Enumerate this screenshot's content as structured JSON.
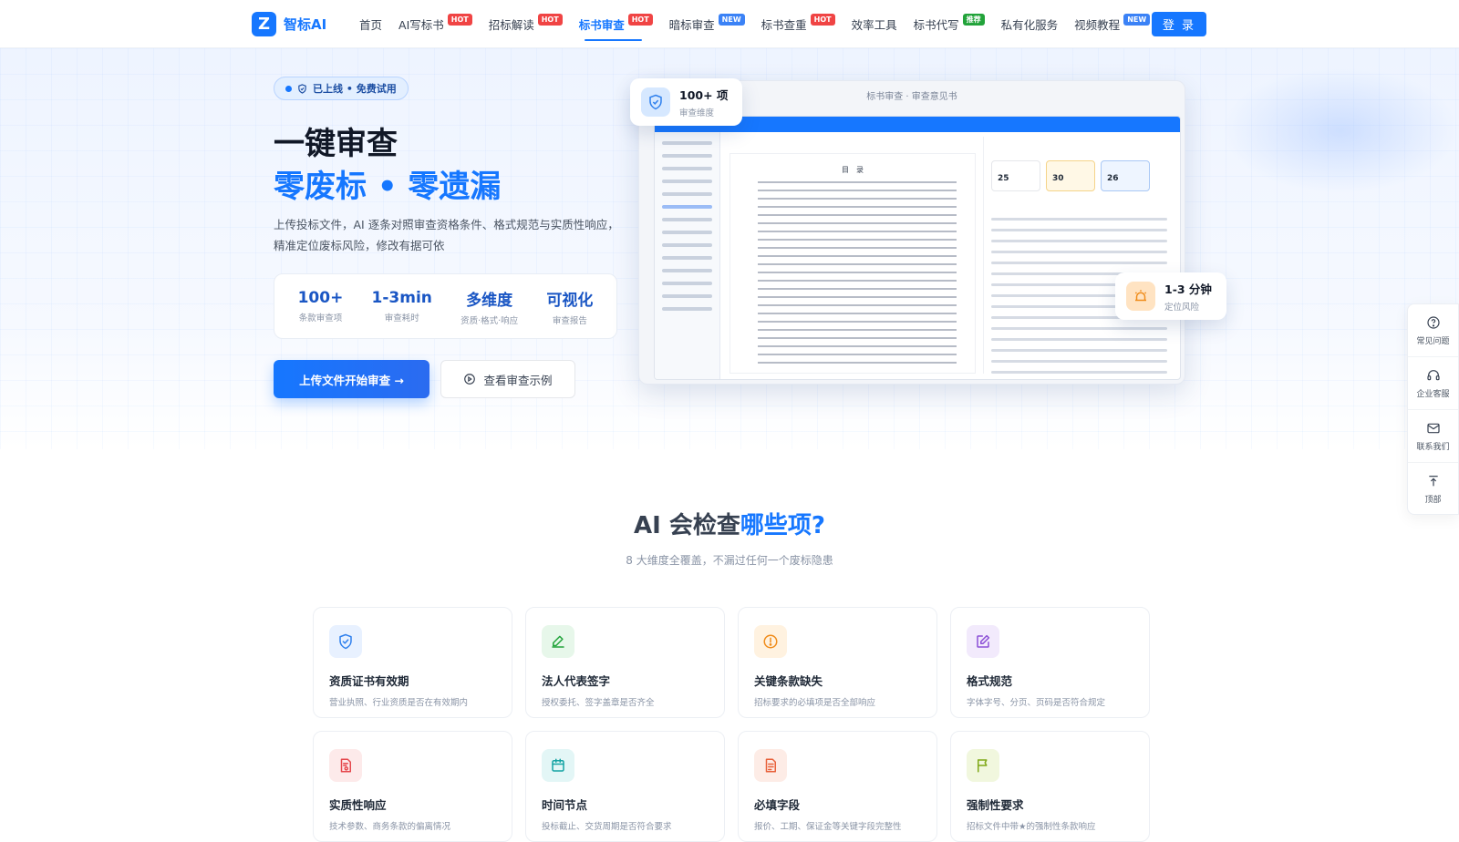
{
  "nav": {
    "logo_mark": "Z",
    "logo_text": "智标AI",
    "items": [
      {
        "label": "首页",
        "badge": ""
      },
      {
        "label": "AI写标书",
        "badge": "HOT"
      },
      {
        "label": "招标解读",
        "badge": "HOT"
      },
      {
        "label": "标书审查",
        "badge": "HOT"
      },
      {
        "label": "暗标审查",
        "badge": "NEW"
      },
      {
        "label": "标书查重",
        "badge": "HOT"
      },
      {
        "label": "效率工具",
        "badge": ""
      },
      {
        "label": "标书代写",
        "badge": "推荐"
      },
      {
        "label": "私有化服务",
        "badge": ""
      },
      {
        "label": "视频教程",
        "badge": "NEW"
      }
    ],
    "active_item": "标书审查",
    "login_label": "登 录"
  },
  "hero": {
    "pill": "已上线 • 免费试用",
    "headline_1": "一键审查",
    "headline_2": "零废标 • 零遗漏",
    "description": "上传投标文件，AI 逐条对照审查资格条件、格式规范与实质性响应，精准定位废标风险，修改有据可依",
    "stats": [
      {
        "value": "100+",
        "label": "条款审查项"
      },
      {
        "value": "1-3min",
        "label": "审查耗时"
      },
      {
        "value": "多维度",
        "label": "资质·格式·响应"
      },
      {
        "value": "可视化",
        "label": "审查报告"
      }
    ],
    "primary_button": "上传文件开始审查 →",
    "secondary_button": "查看审查示例"
  },
  "preview": {
    "title": "标书审查 · 审查意见书",
    "doc_heading": "目　录",
    "score_values": [
      "25",
      "30",
      "26"
    ],
    "float_top": {
      "title": "100+ 项",
      "subtitle": "审查维度"
    },
    "float_right": {
      "title": "1-3 分钟",
      "subtitle": "定位风险"
    }
  },
  "side_tools": [
    {
      "icon": "question-icon",
      "label": "常见问题"
    },
    {
      "icon": "headset-icon",
      "label": "企业客服"
    },
    {
      "icon": "mail-icon",
      "label": "联系我们"
    },
    {
      "icon": "arrow-up-icon",
      "label": "顶部"
    }
  ],
  "section": {
    "title_plain": "AI 会检查",
    "title_highlight": "哪些项?",
    "subtitle": "8 大维度全覆盖，不漏过任何一个废标隐患"
  },
  "cards": [
    {
      "title": "资质证书有效期",
      "desc": "营业执照、行业资质是否在有效期内",
      "icon": "shield-check-icon",
      "color": "#2f80ed",
      "bg": "#e8f1ff"
    },
    {
      "title": "法人代表签字",
      "desc": "授权委托、签字盖章是否齐全",
      "icon": "pen-icon",
      "color": "#22a33a",
      "bg": "#e7f7ea"
    },
    {
      "title": "关键条款缺失",
      "desc": "招标要求的必填项是否全部响应",
      "icon": "alert-circle-icon",
      "color": "#f08c1a",
      "bg": "#fff2e0"
    },
    {
      "title": "格式规范",
      "desc": "字体字号、分页、页码是否符合规定",
      "icon": "edit-icon",
      "color": "#8b4fd6",
      "bg": "#f2eafc"
    },
    {
      "title": "实质性响应",
      "desc": "技术参数、商务条款的偏离情况",
      "icon": "document-seal-icon",
      "color": "#e5484d",
      "bg": "#fdeaea"
    },
    {
      "title": "时间节点",
      "desc": "投标截止、交货周期是否符合要求",
      "icon": "calendar-icon",
      "color": "#14a3a3",
      "bg": "#e3f6f6"
    },
    {
      "title": "必填字段",
      "desc": "报价、工期、保证金等关键字段完整性",
      "icon": "form-list-icon",
      "color": "#e8613a",
      "bg": "#fdece6"
    },
    {
      "title": "强制性要求",
      "desc": "招标文件中带★的强制性条款响应",
      "icon": "flag-icon",
      "color": "#7fa817",
      "bg": "#f1f7de"
    }
  ]
}
